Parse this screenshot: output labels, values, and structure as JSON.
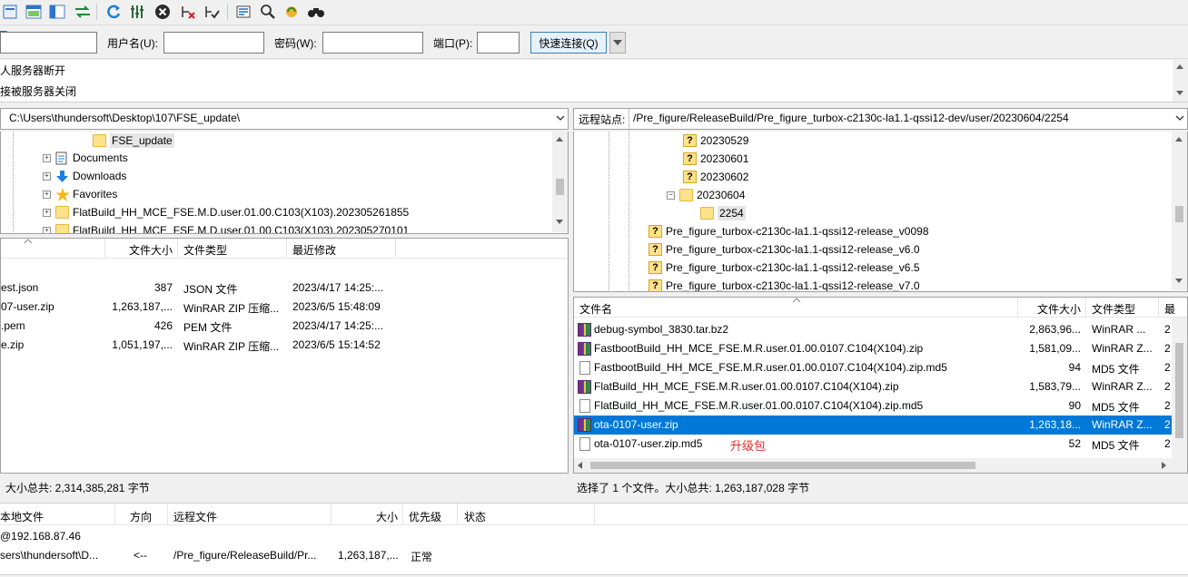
{
  "toolbar": {
    "icons": [
      "site-manager-icon",
      "toggle-log-icon",
      "toggle-tree-icon",
      "toggle-remote-tree-icon",
      "toggle-queue-icon",
      "refresh-icon",
      "process-queue-icon",
      "cancel-icon",
      "disconnect-icon",
      "reconnect-icon",
      "filter-icon",
      "search-icon",
      "sync-browse-icon",
      "find-icon"
    ]
  },
  "quickconnect": {
    "username_label": "用户名(U):",
    "password_label": "密码(W):",
    "port_label": "端口(P):",
    "connect_button": "快速连接(Q)"
  },
  "log": {
    "lines": [
      "人服务器断开",
      "接被服务器关闭"
    ]
  },
  "local": {
    "path": "C:\\Users\\thundersoft\\Desktop\\107\\FSE_update\\",
    "tree": [
      {
        "label": "FSE_update",
        "icon": "folder"
      },
      {
        "label": "Documents",
        "icon": "documents"
      },
      {
        "label": "Downloads",
        "icon": "downloads"
      },
      {
        "label": "Favorites",
        "icon": "favorites"
      },
      {
        "label": "FlatBuild_HH_MCE_FSE.M.D.user.01.00.C103(X103).202305261855",
        "icon": "folder"
      },
      {
        "label": "FlatBuild_HH_MCE_FSE.M.D.user.01.00.C103(X103).202305270101",
        "icon": "folder"
      }
    ],
    "columns": {
      "size": "文件大小",
      "type": "文件类型",
      "modified": "最近修改"
    },
    "files": [
      {
        "name": "est.json",
        "size": "387",
        "type": "JSON 文件",
        "modified": "2023/4/17 14:25:..."
      },
      {
        "name": "07-user.zip",
        "size": "1,263,187,...",
        "type": "WinRAR ZIP 压缩...",
        "modified": "2023/6/5 15:48:09"
      },
      {
        "name": ".pem",
        "size": "426",
        "type": "PEM 文件",
        "modified": "2023/4/17 14:25:..."
      },
      {
        "name": "e.zip",
        "size": "1,051,197,...",
        "type": "WinRAR ZIP 压缩...",
        "modified": "2023/6/5 15:14:52"
      }
    ],
    "status": "大小总共: 2,314,385,281 字节"
  },
  "remote": {
    "site_label": "远程站点:",
    "path": "/Pre_figure/ReleaseBuild/Pre_figure_turbox-c2130c-la1.1-qssi12-dev/user/20230604/2254",
    "tree": [
      {
        "label": "20230529",
        "icon": "unknown"
      },
      {
        "label": "20230601",
        "icon": "unknown"
      },
      {
        "label": "20230602",
        "icon": "unknown"
      },
      {
        "label": "20230604",
        "icon": "folder-open"
      },
      {
        "label": "2254",
        "icon": "folder"
      },
      {
        "label": "Pre_figure_turbox-c2130c-la1.1-qssi12-release_v0098",
        "icon": "unknown"
      },
      {
        "label": "Pre_figure_turbox-c2130c-la1.1-qssi12-release_v6.0",
        "icon": "unknown"
      },
      {
        "label": "Pre_figure_turbox-c2130c-la1.1-qssi12-release_v6.5",
        "icon": "unknown"
      },
      {
        "label": "Pre_figure_turbox-c2130c-la1.1-qssi12-release_v7.0",
        "icon": "unknown"
      }
    ],
    "columns": {
      "name": "文件名",
      "size": "文件大小",
      "type": "文件类型",
      "modified": "最"
    },
    "files": [
      {
        "name": "debug-symbol_3830.tar.bz2",
        "size": "2,863,96...",
        "type": "WinRAR ...",
        "modified": "2",
        "icon": "zip"
      },
      {
        "name": "FastbootBuild_HH_MCE_FSE.M.R.user.01.00.0107.C104(X104).zip",
        "size": "1,581,09...",
        "type": "WinRAR Z...",
        "modified": "2",
        "icon": "zip"
      },
      {
        "name": "FastbootBuild_HH_MCE_FSE.M.R.user.01.00.0107.C104(X104).zip.md5",
        "size": "94",
        "type": "MD5 文件",
        "modified": "2",
        "icon": "doc"
      },
      {
        "name": "FlatBuild_HH_MCE_FSE.M.R.user.01.00.0107.C104(X104).zip",
        "size": "1,583,79...",
        "type": "WinRAR Z...",
        "modified": "2",
        "icon": "zip"
      },
      {
        "name": "FlatBuild_HH_MCE_FSE.M.R.user.01.00.0107.C104(X104).zip.md5",
        "size": "90",
        "type": "MD5 文件",
        "modified": "2",
        "icon": "doc"
      },
      {
        "name": "ota-0107-user.zip",
        "size": "1,263,18...",
        "type": "WinRAR Z...",
        "modified": "2",
        "icon": "zip",
        "selected": true
      },
      {
        "name": "ota-0107-user.zip.md5",
        "size": "52",
        "type": "MD5 文件",
        "modified": "2",
        "icon": "doc",
        "annotation": "升级包"
      }
    ],
    "status": "选择了 1 个文件。大小总共: 1,263,187,028 字节"
  },
  "queue": {
    "columns": {
      "local": "本地文件",
      "direction": "方向",
      "remote": "远程文件",
      "size": "大小",
      "priority": "优先级",
      "status": "状态"
    },
    "server": "@192.168.87.46",
    "item": {
      "local": "sers\\thundersoft\\D...",
      "direction": "<--",
      "remote": "/Pre_figure/ReleaseBuild/Pr...",
      "size": "1,263,187,...",
      "priority": "正常"
    }
  },
  "colors": {
    "selection": "#0078d7",
    "annotation": "#e03030"
  }
}
